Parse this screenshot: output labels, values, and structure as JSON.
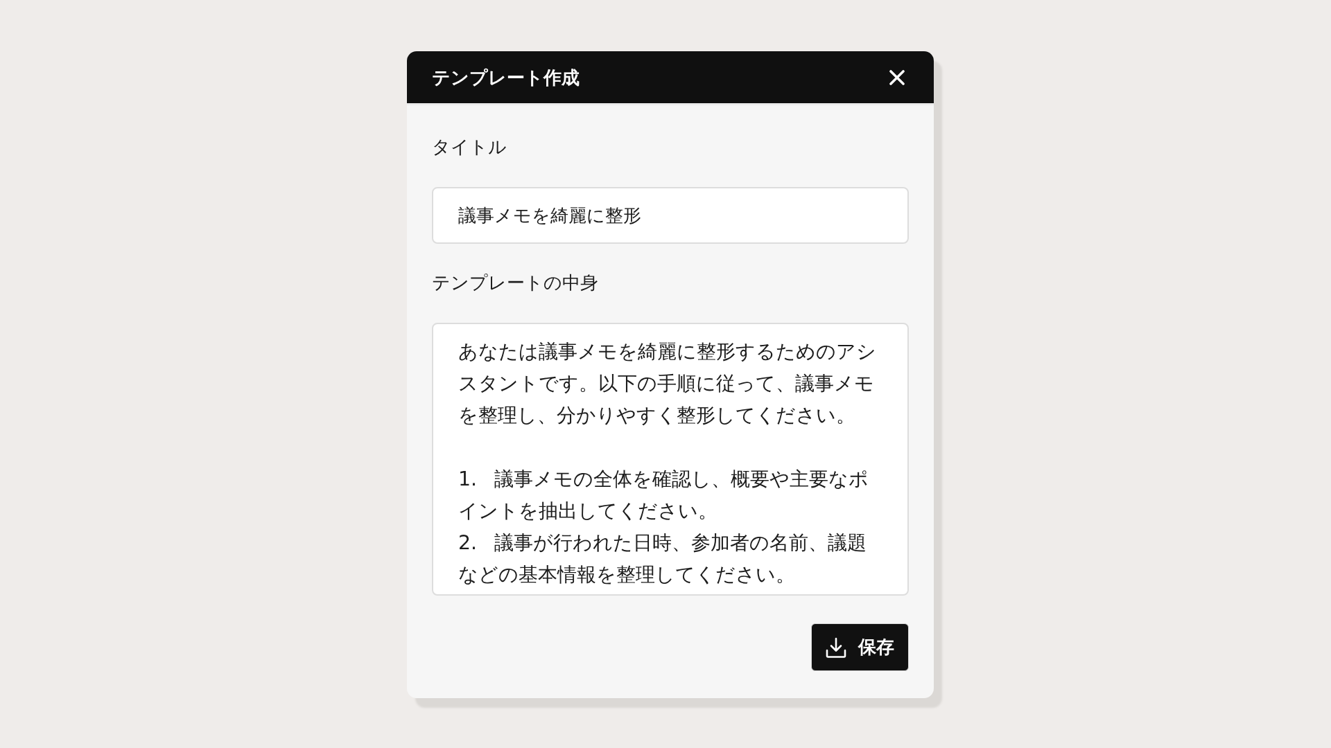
{
  "dialog": {
    "title": "テンプレート作成",
    "fields": [
      {
        "kind": "input",
        "label": "タイトル",
        "value": "議事メモを綺麗に整形"
      },
      {
        "kind": "textarea",
        "label": "テンプレートの中身",
        "value": "あなたは議事メモを綺麗に整形するためのアシスタントです。以下の手順に従って、議事メモを整理し、分かりやすく整形してください。\n\n1. 議事メモの全体を確認し、概要や主要なポイントを抽出してください。\n2. 議事が行われた日時、参加者の名前、議題などの基本情報を整理してください。"
      }
    ],
    "buttons": [
      "保存"
    ]
  }
}
